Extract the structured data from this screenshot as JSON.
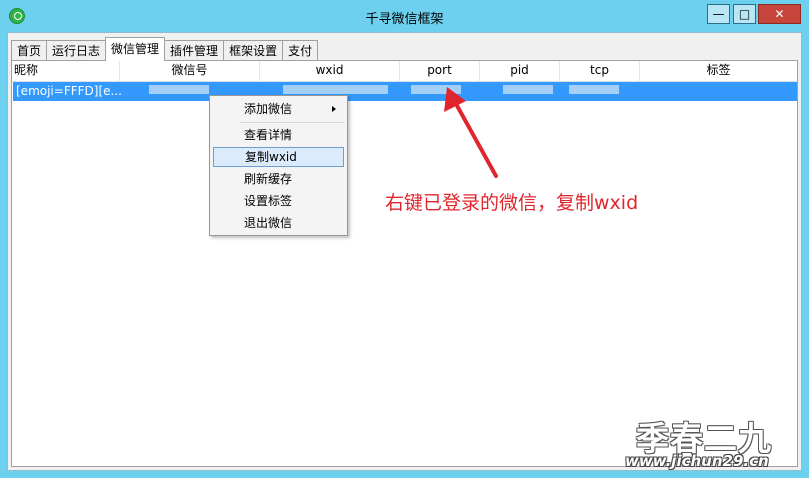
{
  "window": {
    "title": "千寻微信框架",
    "controls": {
      "minimize": "—",
      "maximize": "□",
      "close": "✕"
    }
  },
  "tabs": [
    "首页",
    "运行日志",
    "微信管理",
    "插件管理",
    "框架设置",
    "支付"
  ],
  "active_tab": 2,
  "table": {
    "columns": [
      "昵称",
      "微信号",
      "wxid",
      "port",
      "pid",
      "tcp",
      "标签"
    ],
    "rows": [
      {
        "nickname": "[emoji=FFFD][e..."
      }
    ]
  },
  "context_menu": {
    "items": [
      "添加微信",
      "查看详情",
      "复制wxid",
      "刷新缓存",
      "设置标签",
      "退出微信"
    ],
    "highlighted": "复制wxid"
  },
  "annotation": {
    "text": "右键已登录的微信，复制wxid",
    "color": "#e0262d"
  },
  "watermark": {
    "text": "季春二九",
    "url": "www.jichun29.cn"
  }
}
